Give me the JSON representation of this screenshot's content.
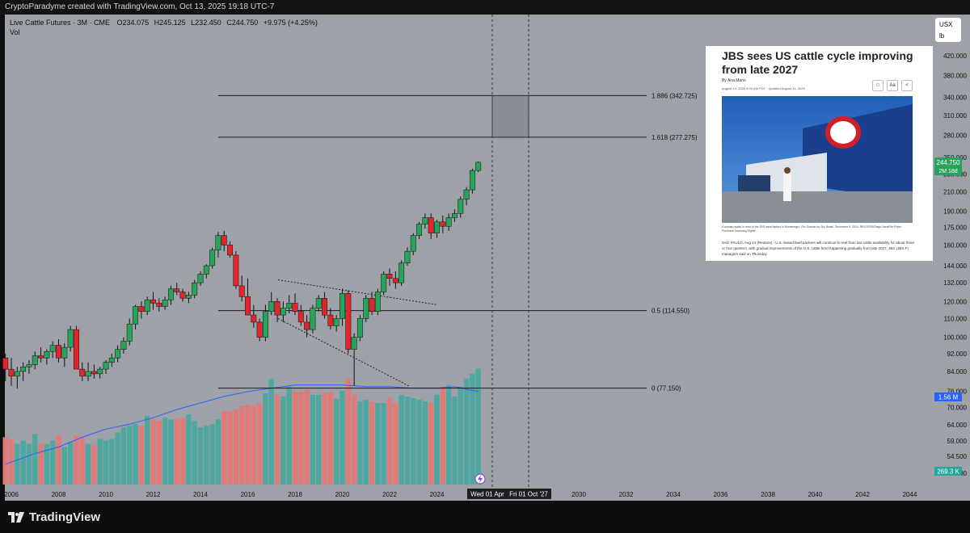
{
  "header": {
    "caption": "CryptoParadyme created with TradingView.com, Oct 13, 2025 19:18 UTC-7"
  },
  "legend": {
    "symbol": "Live Cattle Futures · 3M · CME",
    "open": "O234.075",
    "high": "H245.125",
    "low": "L232.450",
    "close": "C244.750",
    "change": "+9.975 (+4.25%)",
    "volume_label": "Vol"
  },
  "units": {
    "currency": "USX",
    "unit": "lb"
  },
  "price_badge": {
    "value": "244.750",
    "countdown": "2M 18d"
  },
  "volume_badge": "1.56 M",
  "volume_ma_badge": "269.3 K",
  "date_badges": [
    "Wed 01 Apr",
    "Fri 01 Oct '27"
  ],
  "news": {
    "headline": "JBS sees US cattle cycle improving from late 2027",
    "byline": "By Ana Mano",
    "date": "August 14, 2025 8:00 AM PDT · Updated August 14, 2025",
    "photo_caption": "A woman walks in front of the JBS meat factory in Montenegro, Rio Grande do Sul, Brazil, December 9, 2024. REUTERS/Diego Vara/File Photo Purchase Licensing Rights",
    "body": "SAO PAULO, Aug 14 (Reuters) - U.S.-based beef packers will continue to reel from low cattle availability for about three or four quarters, with gradual improvements of the U.S. cattle herd happening gradually from late 2027, JBS (JBS.F) managers said on Thursday.",
    "tools": [
      "bookmark",
      "Aa",
      "share"
    ]
  },
  "brand": "TradingView",
  "colors": {
    "up": "#27a35a",
    "down": "#e0262c",
    "vol_up": "#4fa8a0",
    "vol_down": "#e07a78",
    "ma": "#2962ff",
    "chart_bg": "#9fa1a8"
  },
  "chart_data": {
    "type": "candlestick",
    "interval": "3M",
    "x_ticks": [
      "2006",
      "2008",
      "2010",
      "2012",
      "2014",
      "2016",
      "2018",
      "2020",
      "2022",
      "2024",
      "2026",
      "2028",
      "2030",
      "2032",
      "2034",
      "2036",
      "2038",
      "2040",
      "2042",
      "2044"
    ],
    "y_ticks": [
      "420.000",
      "380.000",
      "340.000",
      "310.000",
      "280.000",
      "250.000",
      "230.000",
      "210.000",
      "190.000",
      "175.000",
      "160.000",
      "144.000",
      "132.000",
      "120.000",
      "110.000",
      "100.000",
      "92.000",
      "84.000",
      "76.000",
      "70.000",
      "64.000",
      "59.000",
      "54.500",
      "50.000"
    ],
    "y_scale": "log",
    "fib_levels": [
      {
        "ratio": "1.886",
        "price": 342.725,
        "label": "1.886 (342.725)"
      },
      {
        "ratio": "1.618",
        "price": 277.275,
        "label": "1.618 (277.275)"
      },
      {
        "ratio": "0.5",
        "price": 114.55,
        "label": "0.5 (114.550)"
      },
      {
        "ratio": "0",
        "price": 77.15,
        "label": "0 (77.150)"
      }
    ],
    "candles": [
      [
        2005.75,
        90,
        92,
        80,
        85
      ],
      [
        2006.0,
        85,
        90,
        78,
        82
      ],
      [
        2006.25,
        82,
        86,
        77,
        84
      ],
      [
        2006.5,
        84,
        88,
        80,
        86
      ],
      [
        2006.75,
        86,
        89,
        83,
        87
      ],
      [
        2007.0,
        87,
        93,
        85,
        91
      ],
      [
        2007.25,
        91,
        95,
        88,
        90
      ],
      [
        2007.5,
        90,
        94,
        87,
        93
      ],
      [
        2007.75,
        93,
        98,
        90,
        96
      ],
      [
        2008.0,
        96,
        99,
        88,
        90
      ],
      [
        2008.25,
        90,
        97,
        86,
        95
      ],
      [
        2008.5,
        95,
        106,
        93,
        104
      ],
      [
        2008.75,
        104,
        106,
        88,
        85
      ],
      [
        2009.0,
        85,
        88,
        80,
        82
      ],
      [
        2009.25,
        82,
        88,
        80,
        84
      ],
      [
        2009.5,
        84,
        87,
        81,
        83
      ],
      [
        2009.75,
        83,
        86,
        81,
        85
      ],
      [
        2010.0,
        85,
        89,
        83,
        88
      ],
      [
        2010.25,
        88,
        92,
        86,
        90
      ],
      [
        2010.5,
        90,
        96,
        88,
        94
      ],
      [
        2010.75,
        94,
        100,
        92,
        98
      ],
      [
        2011.0,
        98,
        110,
        96,
        107
      ],
      [
        2011.25,
        107,
        118,
        104,
        117
      ],
      [
        2011.5,
        117,
        120,
        110,
        114
      ],
      [
        2011.75,
        114,
        123,
        112,
        121
      ],
      [
        2012.0,
        121,
        126,
        115,
        119
      ],
      [
        2012.25,
        119,
        122,
        114,
        117
      ],
      [
        2012.5,
        117,
        123,
        115,
        121
      ],
      [
        2012.75,
        121,
        130,
        118,
        128
      ],
      [
        2013.0,
        128,
        132,
        124,
        126
      ],
      [
        2013.25,
        126,
        128,
        120,
        122
      ],
      [
        2013.5,
        122,
        126,
        119,
        124
      ],
      [
        2013.75,
        124,
        134,
        122,
        132
      ],
      [
        2014.0,
        132,
        140,
        130,
        138
      ],
      [
        2014.25,
        138,
        145,
        135,
        144
      ],
      [
        2014.5,
        144,
        158,
        142,
        156
      ],
      [
        2014.75,
        156,
        171,
        150,
        168
      ],
      [
        2015.0,
        168,
        172,
        155,
        160
      ],
      [
        2015.25,
        160,
        163,
        150,
        152
      ],
      [
        2015.5,
        152,
        155,
        128,
        130
      ],
      [
        2015.75,
        130,
        137,
        120,
        123
      ],
      [
        2016.0,
        123,
        135,
        112,
        112
      ],
      [
        2016.25,
        112,
        118,
        105,
        108
      ],
      [
        2016.5,
        108,
        110,
        98,
        100
      ],
      [
        2016.75,
        100,
        118,
        98,
        114
      ],
      [
        2017.0,
        114,
        126,
        112,
        120
      ],
      [
        2017.25,
        120,
        122,
        108,
        112
      ],
      [
        2017.5,
        112,
        120,
        108,
        116
      ],
      [
        2017.75,
        116,
        124,
        113,
        119
      ],
      [
        2018.0,
        119,
        125,
        112,
        114
      ],
      [
        2018.25,
        114,
        118,
        106,
        108
      ],
      [
        2018.5,
        108,
        112,
        100,
        104
      ],
      [
        2018.75,
        104,
        118,
        102,
        116
      ],
      [
        2019.0,
        116,
        124,
        114,
        122
      ],
      [
        2019.25,
        122,
        126,
        110,
        112
      ],
      [
        2019.5,
        112,
        116,
        104,
        106
      ],
      [
        2019.75,
        106,
        112,
        103,
        110
      ],
      [
        2020.0,
        110,
        128,
        106,
        125
      ],
      [
        2020.25,
        125,
        127,
        92,
        94
      ],
      [
        2020.5,
        94,
        102,
        78,
        100
      ],
      [
        2020.75,
        100,
        112,
        98,
        110
      ],
      [
        2021.0,
        110,
        124,
        108,
        122
      ],
      [
        2021.25,
        122,
        126,
        112,
        114
      ],
      [
        2021.5,
        114,
        128,
        112,
        126
      ],
      [
        2021.75,
        126,
        140,
        124,
        138
      ],
      [
        2022.0,
        138,
        142,
        130,
        135
      ],
      [
        2022.25,
        135,
        140,
        128,
        132
      ],
      [
        2022.5,
        132,
        148,
        130,
        146
      ],
      [
        2022.75,
        146,
        158,
        144,
        155
      ],
      [
        2023.0,
        155,
        170,
        152,
        168
      ],
      [
        2023.25,
        168,
        180,
        165,
        178
      ],
      [
        2023.5,
        178,
        188,
        174,
        184
      ],
      [
        2023.75,
        184,
        188,
        165,
        170
      ],
      [
        2024.0,
        170,
        182,
        166,
        180
      ],
      [
        2024.25,
        180,
        186,
        170,
        176
      ],
      [
        2024.5,
        176,
        188,
        172,
        184
      ],
      [
        2024.75,
        184,
        192,
        180,
        188
      ],
      [
        2025.0,
        188,
        205,
        184,
        202
      ],
      [
        2025.25,
        202,
        215,
        196,
        212
      ],
      [
        2025.5,
        212,
        236,
        208,
        234
      ],
      [
        2025.75,
        234,
        245,
        232,
        244
      ]
    ],
    "volume": [
      [
        2005.75,
        0.58,
        "down"
      ],
      [
        2006.0,
        0.55,
        "down"
      ],
      [
        2006.25,
        0.5,
        "up"
      ],
      [
        2006.5,
        0.54,
        "up"
      ],
      [
        2006.75,
        0.5,
        "up"
      ],
      [
        2007.0,
        0.62,
        "up"
      ],
      [
        2007.25,
        0.5,
        "down"
      ],
      [
        2007.5,
        0.5,
        "up"
      ],
      [
        2007.75,
        0.54,
        "up"
      ],
      [
        2008.0,
        0.6,
        "down"
      ],
      [
        2008.25,
        0.46,
        "up"
      ],
      [
        2008.5,
        0.52,
        "up"
      ],
      [
        2008.75,
        0.6,
        "down"
      ],
      [
        2009.0,
        0.58,
        "down"
      ],
      [
        2009.25,
        0.5,
        "up"
      ],
      [
        2009.5,
        0.48,
        "down"
      ],
      [
        2009.75,
        0.56,
        "up"
      ],
      [
        2010.0,
        0.54,
        "up"
      ],
      [
        2010.25,
        0.56,
        "up"
      ],
      [
        2010.5,
        0.64,
        "up"
      ],
      [
        2010.75,
        0.7,
        "up"
      ],
      [
        2011.0,
        0.72,
        "up"
      ],
      [
        2011.25,
        0.74,
        "up"
      ],
      [
        2011.5,
        0.72,
        "down"
      ],
      [
        2011.75,
        0.84,
        "up"
      ],
      [
        2012.0,
        0.8,
        "down"
      ],
      [
        2012.25,
        0.78,
        "down"
      ],
      [
        2012.5,
        0.82,
        "up"
      ],
      [
        2012.75,
        0.8,
        "up"
      ],
      [
        2013.0,
        0.8,
        "down"
      ],
      [
        2013.25,
        0.82,
        "down"
      ],
      [
        2013.5,
        0.86,
        "up"
      ],
      [
        2013.75,
        0.78,
        "up"
      ],
      [
        2014.0,
        0.7,
        "up"
      ],
      [
        2014.25,
        0.72,
        "up"
      ],
      [
        2014.5,
        0.74,
        "up"
      ],
      [
        2014.75,
        0.8,
        "up"
      ],
      [
        2015.0,
        0.9,
        "down"
      ],
      [
        2015.25,
        0.9,
        "down"
      ],
      [
        2015.5,
        0.92,
        "down"
      ],
      [
        2015.75,
        0.96,
        "down"
      ],
      [
        2016.0,
        0.98,
        "down"
      ],
      [
        2016.25,
        0.96,
        "down"
      ],
      [
        2016.5,
        1.0,
        "down"
      ],
      [
        2016.75,
        1.12,
        "up"
      ],
      [
        2017.0,
        1.3,
        "up"
      ],
      [
        2017.25,
        1.1,
        "down"
      ],
      [
        2017.5,
        1.08,
        "up"
      ],
      [
        2017.75,
        1.2,
        "up"
      ],
      [
        2018.0,
        1.14,
        "down"
      ],
      [
        2018.25,
        1.14,
        "down"
      ],
      [
        2018.5,
        1.16,
        "down"
      ],
      [
        2018.75,
        1.1,
        "up"
      ],
      [
        2019.0,
        1.1,
        "up"
      ],
      [
        2019.25,
        1.12,
        "down"
      ],
      [
        2019.5,
        1.14,
        "down"
      ],
      [
        2019.75,
        1.05,
        "up"
      ],
      [
        2020.0,
        1.15,
        "up"
      ],
      [
        2020.25,
        1.3,
        "down"
      ],
      [
        2020.5,
        1.1,
        "down"
      ],
      [
        2020.75,
        1.02,
        "up"
      ],
      [
        2021.0,
        1.04,
        "up"
      ],
      [
        2021.25,
        1.02,
        "down"
      ],
      [
        2021.5,
        1.0,
        "up"
      ],
      [
        2021.75,
        1.0,
        "up"
      ],
      [
        2022.0,
        1.06,
        "down"
      ],
      [
        2022.25,
        1.0,
        "down"
      ],
      [
        2022.5,
        1.1,
        "up"
      ],
      [
        2022.75,
        1.08,
        "up"
      ],
      [
        2023.0,
        1.06,
        "up"
      ],
      [
        2023.25,
        1.04,
        "up"
      ],
      [
        2023.5,
        1.02,
        "up"
      ],
      [
        2023.75,
        1.0,
        "down"
      ],
      [
        2024.0,
        1.1,
        "up"
      ],
      [
        2024.25,
        1.2,
        "down"
      ],
      [
        2024.5,
        1.22,
        "up"
      ],
      [
        2024.75,
        1.08,
        "up"
      ],
      [
        2025.0,
        1.2,
        "up"
      ],
      [
        2025.25,
        1.3,
        "up"
      ],
      [
        2025.5,
        1.36,
        "up"
      ],
      [
        2025.75,
        1.42,
        "up"
      ]
    ],
    "volume_ma": [
      [
        2005.75,
        0.25
      ],
      [
        2007.0,
        0.38
      ],
      [
        2008.0,
        0.46
      ],
      [
        2009.0,
        0.58
      ],
      [
        2010.0,
        0.68
      ],
      [
        2011.0,
        0.74
      ],
      [
        2012.0,
        0.82
      ],
      [
        2013.0,
        0.92
      ],
      [
        2014.0,
        1.0
      ],
      [
        2015.0,
        1.08
      ],
      [
        2016.0,
        1.14
      ],
      [
        2017.0,
        1.18
      ],
      [
        2018.0,
        1.22
      ],
      [
        2019.0,
        1.22
      ],
      [
        2020.0,
        1.22
      ],
      [
        2021.0,
        1.2
      ],
      [
        2022.0,
        1.2
      ],
      [
        2023.0,
        1.18
      ],
      [
        2024.0,
        1.18
      ],
      [
        2024.75,
        1.2
      ],
      [
        2025.75,
        1.14
      ]
    ]
  }
}
